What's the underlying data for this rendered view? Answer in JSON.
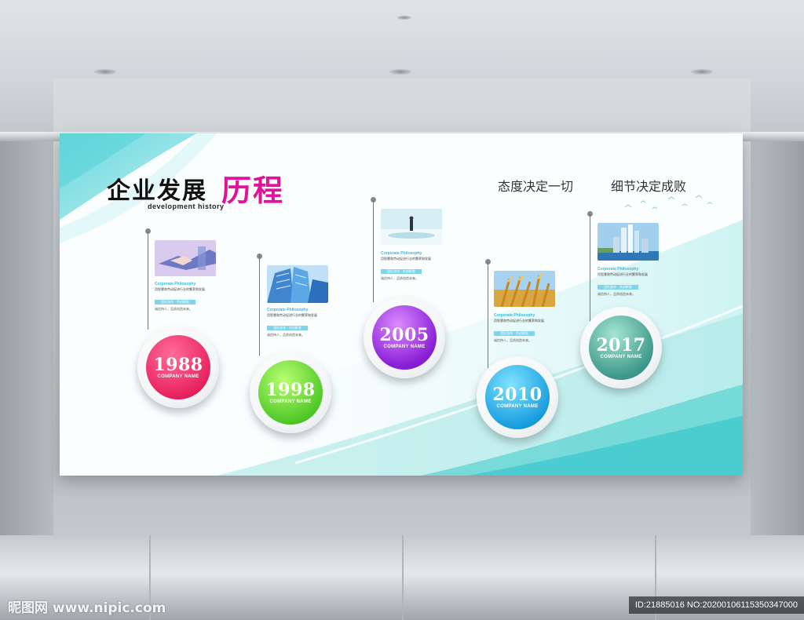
{
  "board": {
    "title_main": "企业发展",
    "title_highlight": "历程",
    "subtitle_en": "development history",
    "slogan_left": "态度决定一切",
    "slogan_right": "细节决定成败",
    "colors": {
      "accent_title": "#e0149a",
      "wave": "#7fd9dc",
      "tag": "#7fd3ea"
    }
  },
  "milestones": [
    {
      "year": "1988",
      "company": "COMPANY  NAME",
      "color": "#e8245f",
      "color2": "#ff5a8a",
      "photo_icon": "handshake-photo",
      "philosophy": "Corporate Philosophy",
      "body": "用智慧和劳动促进行业的繁荣和发展",
      "tag": "团队协作 · 共创辉煌",
      "foot": "诚信待人，品质创造未来。"
    },
    {
      "year": "1998",
      "company": "COMPANY  NAME",
      "color": "#52c92a",
      "color2": "#9af24e",
      "photo_icon": "skyscraper-photo",
      "philosophy": "Corporate Philosophy",
      "body": "用智慧和劳动促进行业的繁荣和发展",
      "tag": "团队协作 · 共创辉煌",
      "foot": "诚信待人，品质创造未来。"
    },
    {
      "year": "2005",
      "company": "COMPANY  NAME",
      "color": "#8a1fd6",
      "color2": "#c15cf5",
      "photo_icon": "businessman-photo",
      "philosophy": "Corporate Philosophy",
      "body": "用智慧和劳动促进行业的繁荣和发展",
      "tag": "团队协作 · 共创辉煌",
      "foot": "诚信待人，品质创造未来。"
    },
    {
      "year": "2010",
      "company": "COMPANY  NAME",
      "color": "#1b9fe0",
      "color2": "#5fd0ff",
      "photo_icon": "wheat-photo",
      "philosophy": "Corporate Philosophy",
      "body": "用智慧和劳动促进行业的繁荣和发展",
      "tag": "团队协作 · 共创辉煌",
      "foot": "诚信待人，品质创造未来。"
    },
    {
      "year": "2017",
      "company": "COMPANY  NAME",
      "color": "#3f9a8a",
      "color2": "#7fcdbb",
      "photo_icon": "city-skyline-photo",
      "philosophy": "Corporate Philosophy",
      "body": "用智慧和劳动促进行业的繁荣和发展",
      "tag": "团队协作 · 共创辉煌",
      "foot": "诚信待人，品质创造未来。"
    }
  ],
  "watermark": {
    "left": "昵图网 www.nipic.com",
    "right": "ID:21885016 NO:20200106115350347000"
  }
}
